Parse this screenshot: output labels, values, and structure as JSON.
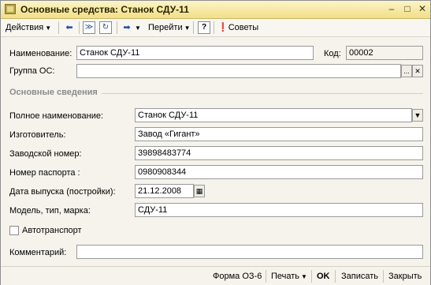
{
  "window": {
    "title": "Основные средства: Станок СДУ-11",
    "minimize_icon": "minimize-icon",
    "maximize_icon": "maximize-icon",
    "close_icon": "close-icon"
  },
  "toolbar": {
    "actions_label": "Действия",
    "goto_label": "Перейти",
    "help_glyph": "?",
    "tips_label": "Советы"
  },
  "form": {
    "name_label": "Наименование:",
    "name_value": "Станок СДУ-11",
    "code_label": "Код:",
    "code_value": "00002",
    "group_label": "Группа ОС:",
    "group_value": "",
    "section_title": "Основные сведения",
    "full_name_label": "Полное наименование:",
    "full_name_value": "Станок СДУ-11",
    "manufacturer_label": "Изготовитель:",
    "manufacturer_value": "Завод «Гигант»",
    "serial_label": "Заводской номер:",
    "serial_value": "39898483774",
    "passport_label": "Номер паспорта :",
    "passport_value": "0980908344",
    "release_date_label": "Дата выпуска (постройки):",
    "release_date_value": "21.12.2008",
    "model_label": "Модель, тип, марка:",
    "model_value": "СДУ-11",
    "vehicle_label": "Автотранспорт",
    "vehicle_checked": false,
    "comment_label": "Комментарий:",
    "comment_value": ""
  },
  "bottom": {
    "form_os6": "Форма ОЗ-6",
    "print_label": "Печать",
    "ok_label": "OK",
    "save_label": "Записать",
    "close_label": "Закрыть"
  }
}
